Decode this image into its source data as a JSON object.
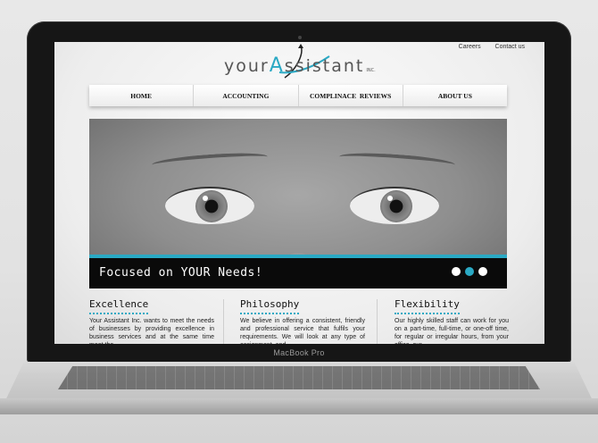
{
  "device": {
    "brand_label": "MacBook Pro"
  },
  "site": {
    "top_links": [
      "Careers",
      "Contact us"
    ],
    "logo": {
      "part1": "your",
      "letter": "A",
      "part2": "ssistant",
      "suffix": "INC."
    },
    "nav": [
      "HOME",
      "ACCOUNTING",
      "COMPLINACE  REVIEWS",
      "ABOUT US"
    ],
    "hero": {
      "caption": "Focused on YOUR Needs!",
      "slides": 3,
      "active_slide": 2,
      "accent": "#2aa9c4"
    },
    "columns": [
      {
        "title": "Excellence",
        "text": "Your Assistant Inc. wants to meet the needs of businesses by providing excellence in business services and at the same time meet the"
      },
      {
        "title": "Philosophy",
        "text": "We believe in offering a consistent, friendly and professional service that fulfils your requirements. We will look at any type of assignment, and"
      },
      {
        "title": "Flexibility",
        "text": "Our highly skilled staff can work for you on a part-time, full-time, or one-off time, for regular or irregular hours, from your office, our"
      }
    ]
  }
}
